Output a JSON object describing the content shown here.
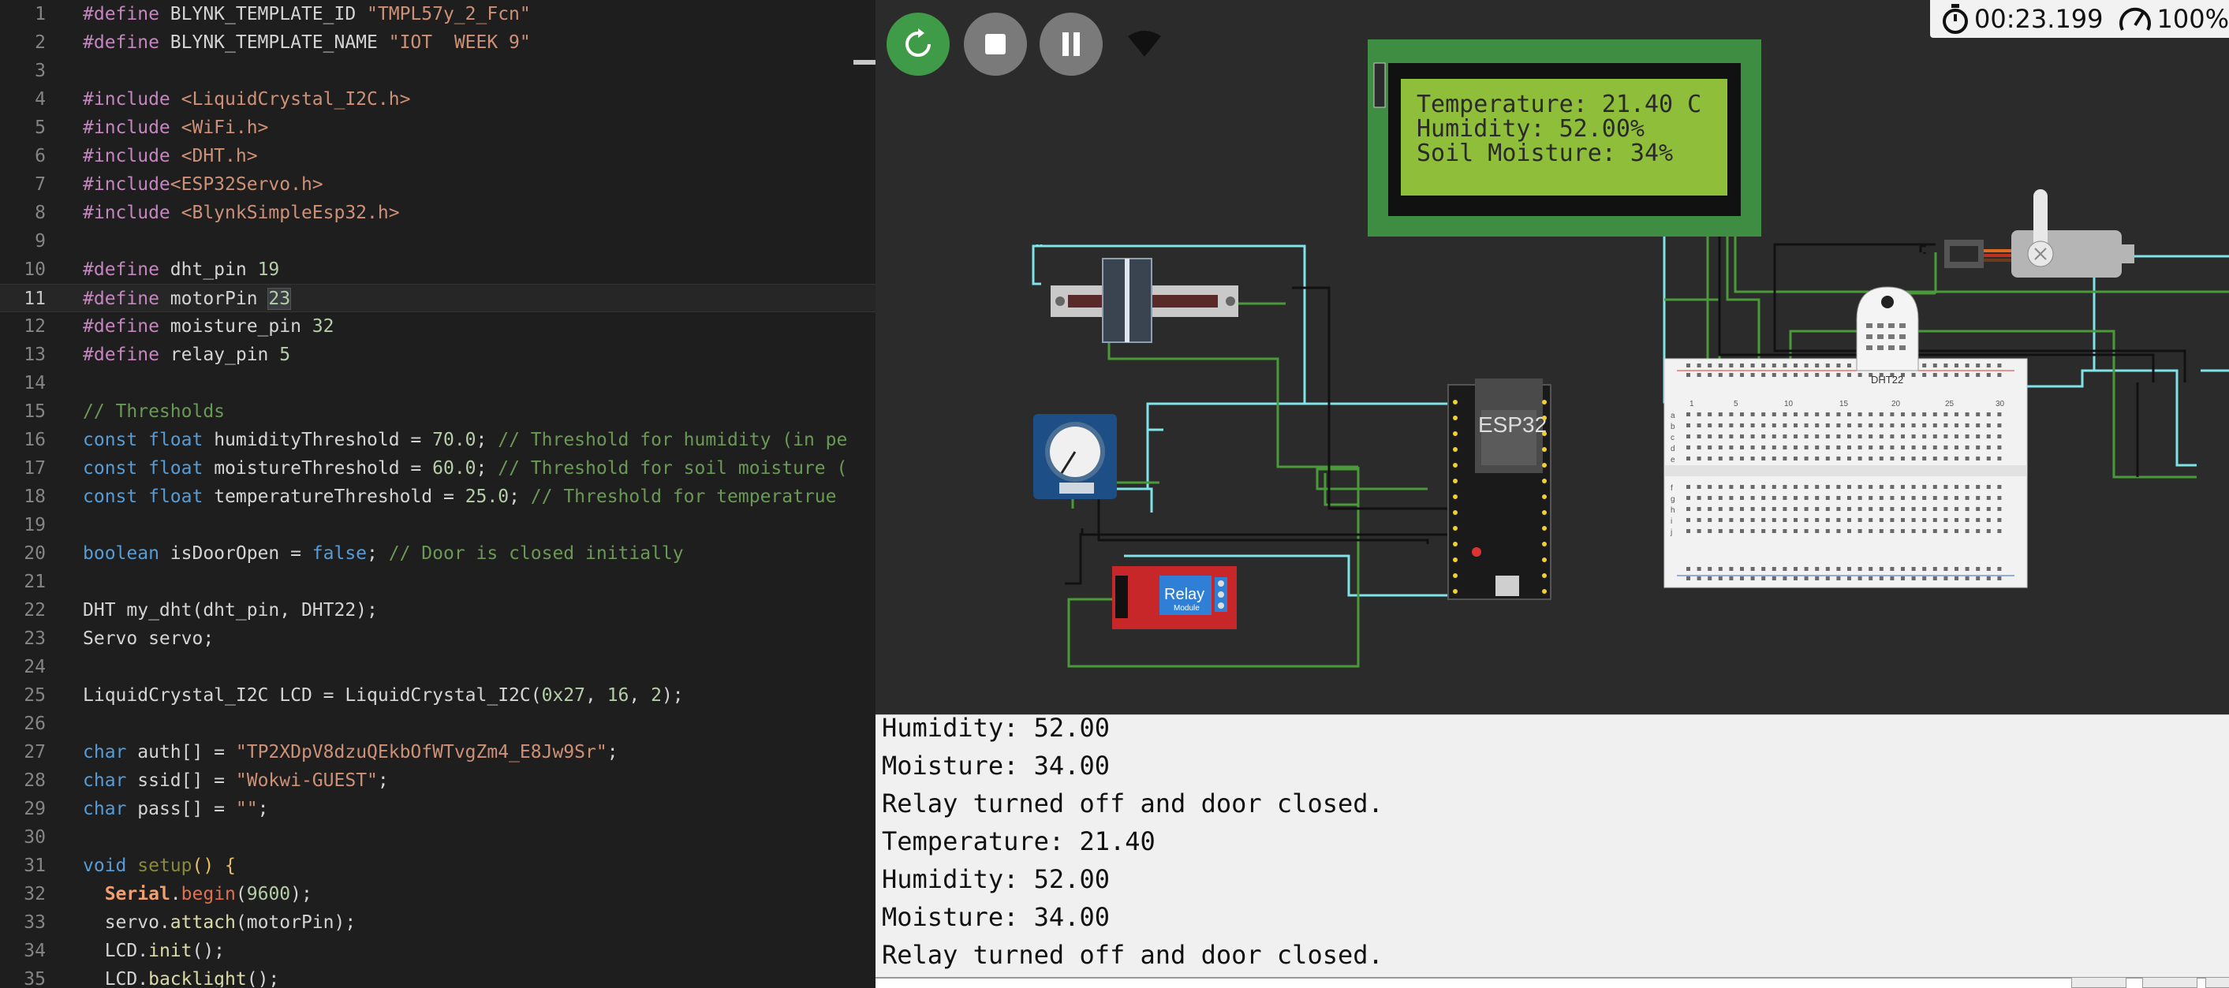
{
  "editor": {
    "line_numbers": [
      "1",
      "2",
      "3",
      "4",
      "5",
      "6",
      "7",
      "8",
      "9",
      "10",
      "11",
      "12",
      "13",
      "14",
      "15",
      "16",
      "17",
      "18",
      "19",
      "20",
      "21",
      "22",
      "23",
      "24",
      "25",
      "26",
      "27",
      "28",
      "29",
      "30",
      "31",
      "32",
      "33",
      "34",
      "35"
    ],
    "lines": {
      "l1a": "#define ",
      "l1b": "BLYNK_TEMPLATE_ID ",
      "l1c": "\"TMPL57y_2_Fcn\"",
      "l2a": "#define ",
      "l2b": "BLYNK_TEMPLATE_NAME ",
      "l2c": "\"IOT  WEEK 9\"",
      "l4a": "#include ",
      "l4b": "<LiquidCrystal_I2C.h>",
      "l5a": "#include ",
      "l5b": "<WiFi.h>",
      "l6a": "#include ",
      "l6b": "<DHT.h>",
      "l7a": "#include",
      "l7b": "<ESP32Servo.h>",
      "l8a": "#include ",
      "l8b": "<BlynkSimpleEsp32.h>",
      "l10a": "#define ",
      "l10b": "dht_pin ",
      "l10c": "19",
      "l11a": "#define ",
      "l11b": "motorPin ",
      "l11c": "23",
      "l12a": "#define ",
      "l12b": "moisture_pin ",
      "l12c": "32",
      "l13a": "#define ",
      "l13b": "relay_pin ",
      "l13c": "5",
      "l15a": "// Thresholds",
      "l16a": "const ",
      "l16b": "float ",
      "l16c": "humidityThreshold = ",
      "l16d": "70.0",
      "l16e": "; ",
      "l16f": "// Threshold for humidity (in pe",
      "l17a": "const ",
      "l17b": "float ",
      "l17c": "moistureThreshold = ",
      "l17d": "60.0",
      "l17e": "; ",
      "l17f": "// Threshold for soil moisture (",
      "l18a": "const ",
      "l18b": "float ",
      "l18c": "temperatureThreshold = ",
      "l18d": "25.0",
      "l18e": "; ",
      "l18f": "// Threshold for temperatrue",
      "l20a": "boolean ",
      "l20b": "isDoorOpen = ",
      "l20c": "false",
      "l20d": "; ",
      "l20e": "// Door is closed initially",
      "l22a": "DHT my_dht(dht_pin, DHT22);",
      "l23a": "Servo servo;",
      "l25a": "LiquidCrystal_I2C LCD = LiquidCrystal_I2C(",
      "l25b": "0x27",
      "l25c": ", ",
      "l25d": "16",
      "l25e": ", ",
      "l25f": "2",
      "l25g": ");",
      "l27a": "char ",
      "l27b": "auth[] = ",
      "l27c": "\"TP2XDpV8dzuQEkbOfWTvgZm4_E8Jw9Sr\"",
      "l27d": ";",
      "l28a": "char ",
      "l28b": "ssid[] = ",
      "l28c": "\"Wokwi-GUEST\"",
      "l28d": ";",
      "l29a": "char ",
      "l29b": "pass[] = ",
      "l29c": "\"\"",
      "l29d": ";",
      "l31a": "void ",
      "l31b": "setup",
      "l31c": "() {",
      "l32a": "  ",
      "l32b": "Serial",
      "l32c": ".",
      "l32d": "begin",
      "l32e": "(",
      "l32f": "9600",
      "l32g": ");",
      "l33a": "  servo.",
      "l33b": "attach",
      "l33c": "(motorPin);",
      "l34a": "  LCD.",
      "l34b": "init",
      "l34c": "();",
      "l35a": "  LCD.",
      "l35b": "backlight",
      "l35c": "();"
    }
  },
  "simulator": {
    "timer": "00:23.199",
    "speed": "100%",
    "lcd_lines": [
      "Temperature: 21.40 C",
      "Humidity: 52.00%",
      "Soil Moisture: 34%"
    ],
    "esp32_label": "ESP32",
    "relay_label": "Relay",
    "relay_sublabel": "Module",
    "dht_label": "DHT22",
    "breadboard_columns": [
      "1",
      "5",
      "10",
      "15",
      "20",
      "25",
      "30"
    ],
    "breadboard_rows_top": [
      "a",
      "b",
      "c",
      "d",
      "e"
    ],
    "breadboard_rows_bottom": [
      "f",
      "g",
      "h",
      "i",
      "j"
    ]
  },
  "serial_monitor": {
    "lines": [
      "Humidity: 52.00",
      "Moisture: 34.00",
      "Relay turned off and door closed.",
      "Temperature: 21.40",
      "Humidity: 52.00",
      "Moisture: 34.00",
      "Relay turned off and door closed."
    ]
  },
  "colors": {
    "run_green": "#3f9b47",
    "control_gray": "#7a7a7a",
    "lcd_green": "#8fbf3a",
    "lcd_frame": "#3f8c43",
    "wire_cyan": "#7fe3e8",
    "wire_green": "#4a9a3a",
    "relay_red": "#c8272a"
  }
}
